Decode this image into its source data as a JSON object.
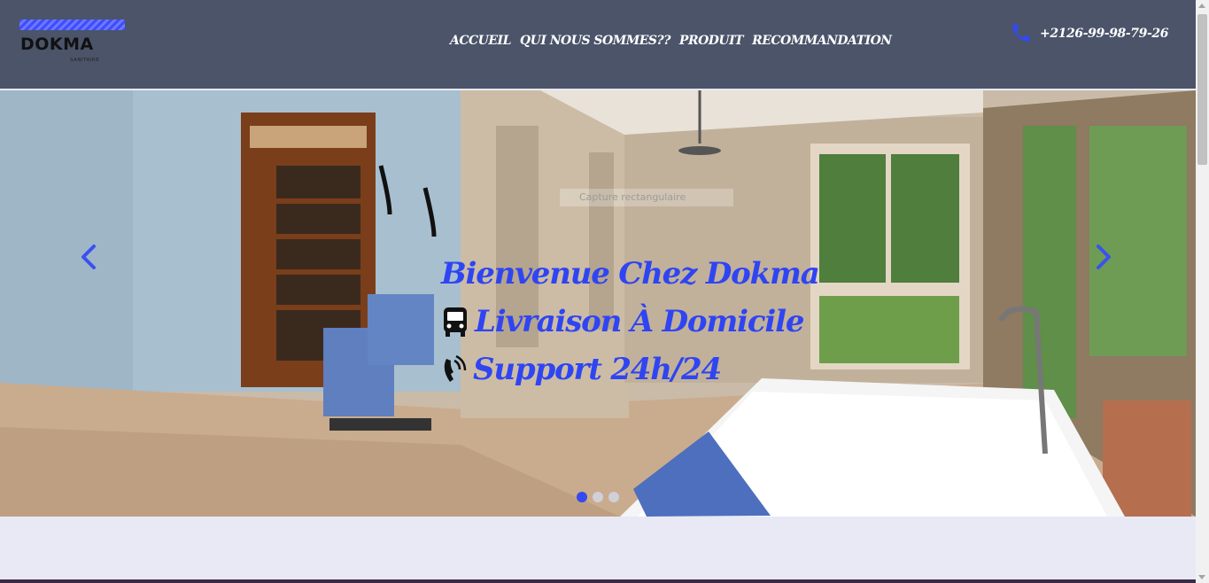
{
  "brand": {
    "name": "DOKMA",
    "tagline": "SANITAIRE"
  },
  "nav": {
    "items": [
      {
        "label": "ACCUEIL"
      },
      {
        "label": "QUI NOUS SOMMES??"
      },
      {
        "label": "PRODUIT"
      },
      {
        "label": "RECOMMANDATION"
      }
    ]
  },
  "contact": {
    "phone": "+2126-99-98-79-26",
    "icon": "phone-icon"
  },
  "carousel": {
    "image_caption": "Capture rectangulaire",
    "lines": [
      {
        "text": "Bienvenue Chez Dokma",
        "icon": ""
      },
      {
        "text": "Livraison À Domicile",
        "icon": "bus-icon"
      },
      {
        "text": "Support 24h/24",
        "icon": "phone-ringing-icon"
      }
    ],
    "indicators": 3,
    "active_index": 0
  },
  "colors": {
    "header_bg": "#4b5469",
    "accent": "#2f45f2",
    "page_bg": "#e8e9f4"
  }
}
